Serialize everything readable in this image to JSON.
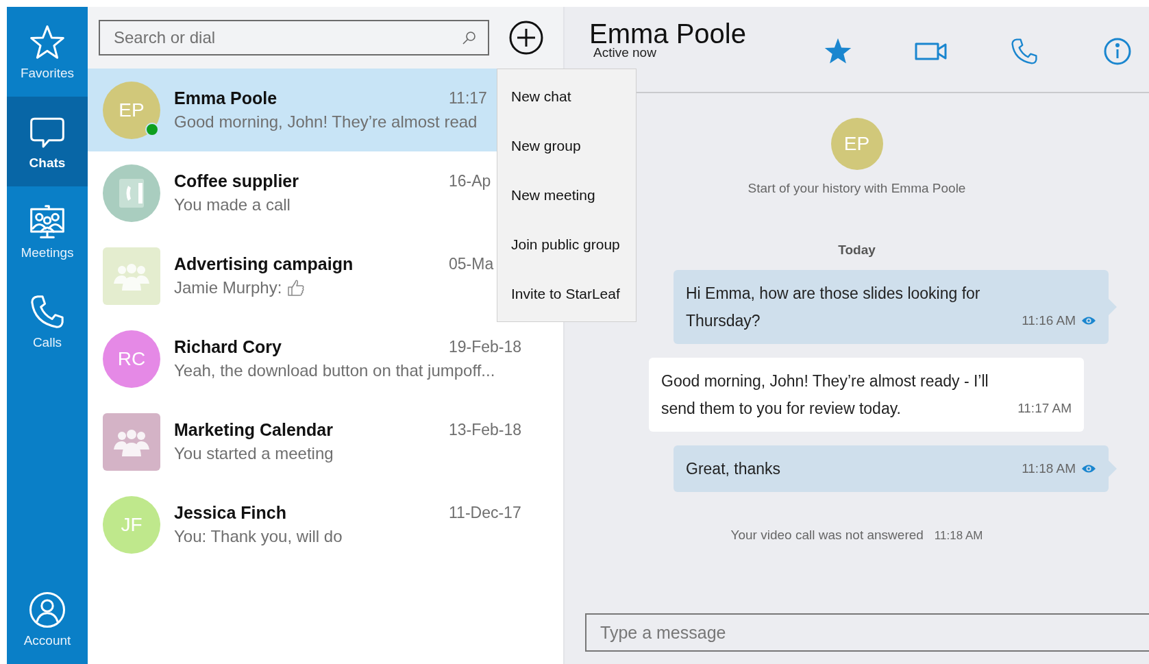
{
  "nav": {
    "items": [
      {
        "label": "Favorites",
        "kind": "star",
        "selected": false
      },
      {
        "label": "Chats",
        "kind": "chat",
        "selected": true
      },
      {
        "label": "Meetings",
        "kind": "meeting",
        "selected": false
      },
      {
        "label": "Calls",
        "kind": "phone",
        "selected": false
      }
    ],
    "account": {
      "label": "Account"
    }
  },
  "search": {
    "placeholder": "Search or dial"
  },
  "chats": [
    {
      "kind": "person",
      "initials": "EP",
      "color": "#d1c87a",
      "online": true,
      "name": "Emma Poole",
      "time": "11:17",
      "preview": "Good morning, John! They’re almost read",
      "liked": false,
      "selected": true
    },
    {
      "kind": "contact",
      "color": "#a9cdbf",
      "online": false,
      "name": "Coffee supplier",
      "time": "16-Ap",
      "preview": "You made a call",
      "liked": false,
      "selected": false
    },
    {
      "kind": "group",
      "color": "#e4edcf",
      "online": false,
      "name": "Advertising campaign",
      "time": "05-Ma",
      "preview": "Jamie Murphy:",
      "liked": true,
      "selected": false
    },
    {
      "kind": "person",
      "initials": "RC",
      "color": "#e589e6",
      "online": false,
      "name": "Richard Cory",
      "time": "19-Feb-18",
      "preview": "Yeah, the download button on that jumpoff...",
      "liked": false,
      "selected": false
    },
    {
      "kind": "group",
      "color": "#d4b3c6",
      "online": false,
      "name": "Marketing Calendar",
      "time": "13-Feb-18",
      "preview": "You started a meeting",
      "liked": false,
      "selected": false
    },
    {
      "kind": "person",
      "initials": "JF",
      "color": "#bfe88c",
      "online": false,
      "name": "Jessica Finch",
      "time": "11-Dec-17",
      "preview": "You: Thank you, will do",
      "liked": false,
      "selected": false
    }
  ],
  "new_menu": {
    "items": [
      "New chat",
      "New group",
      "New meeting",
      "Join public group",
      "Invite to StarLeaf"
    ]
  },
  "conversation": {
    "name": "Emma Poole",
    "status": "Active now",
    "initials": "EP",
    "history_note": "Start of your history with Emma Poole",
    "timeline": [
      {
        "kind": "date",
        "text": "Today"
      },
      {
        "kind": "outgoing",
        "text": "Hi Emma, how are those slides looking for Thursday?",
        "time": "11:16 AM",
        "seen": true
      },
      {
        "kind": "incoming",
        "text": "Good morning, John! They’re almost ready - I’ll send them to you for review today.",
        "time": "11:17 AM"
      },
      {
        "kind": "outgoing",
        "text": "Great, thanks",
        "time": "11:18 AM",
        "seen": true
      },
      {
        "kind": "event",
        "text": "Your video call was not answered",
        "time": "11:18 AM"
      }
    ],
    "composer": {
      "placeholder": "Type a message"
    }
  }
}
